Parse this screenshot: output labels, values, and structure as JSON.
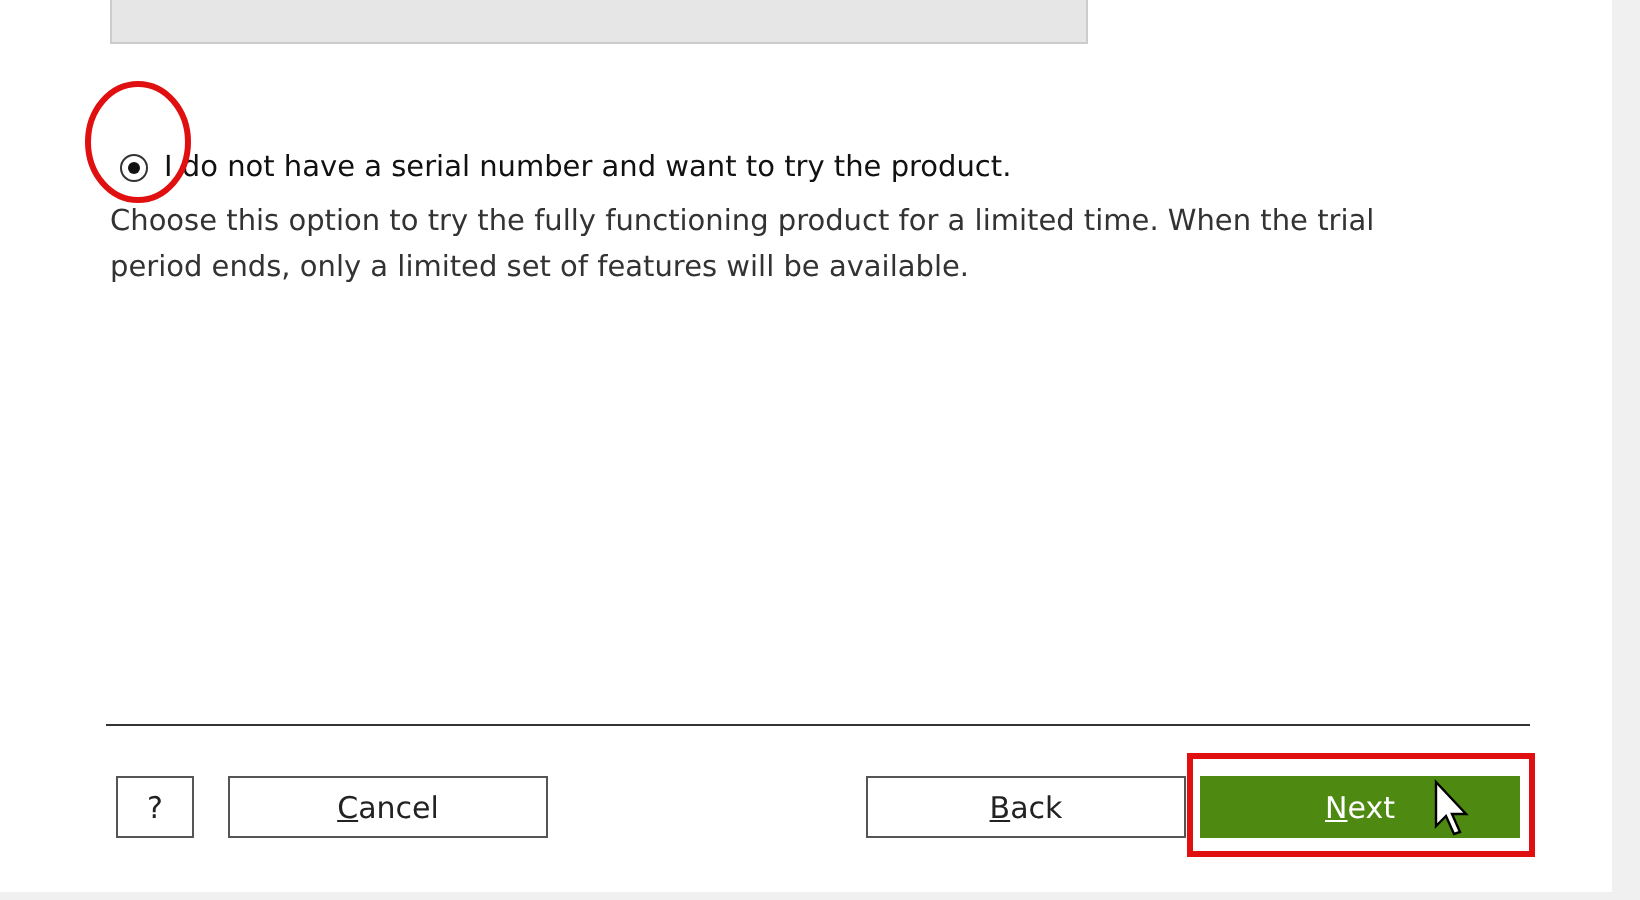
{
  "serial_field": {
    "disabled": true
  },
  "trial_option": {
    "label": "I do not have a serial number and want to try the product.",
    "selected": true,
    "description": "Choose this option to try the fully functioning product for a limited time. When the trial period ends, only a limited set of features will be available."
  },
  "buttons": [
    {
      "kind": "help",
      "label": "?",
      "underline_first": false
    },
    {
      "kind": "secondary",
      "label": "Cancel",
      "underline_first": true
    },
    {
      "kind": "secondary",
      "label": "Back",
      "underline_first": true
    },
    {
      "kind": "primary",
      "label": "Next",
      "underline_first": true
    }
  ],
  "annotations": [
    {
      "kind": "circle"
    },
    {
      "kind": "rectangle"
    }
  ],
  "pointer": {
    "kind": "cursor"
  }
}
